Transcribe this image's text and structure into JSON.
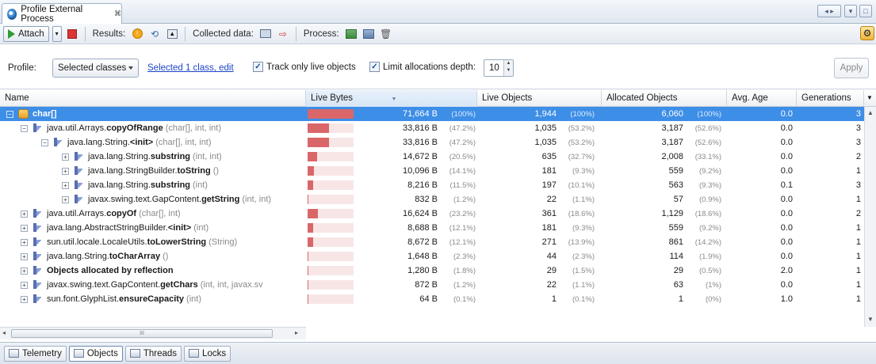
{
  "window": {
    "tab_title": "Profile External Process",
    "tab_close": "⌘"
  },
  "toolbar": {
    "attach_label": "Attach",
    "results_label": "Results:",
    "collected_label": "Collected data:",
    "process_label": "Process:"
  },
  "options": {
    "profile_label": "Profile:",
    "profile_value": "Selected classes",
    "selected_link": "Selected 1 class, edit",
    "track_live_label": "Track only live objects",
    "limit_depth_label": "Limit allocations depth:",
    "depth_value": "10",
    "apply_label": "Apply"
  },
  "columns": [
    "Name",
    "Live Bytes",
    "Live Objects",
    "Allocated Objects",
    "Avg. Age",
    "Generations"
  ],
  "rows": [
    {
      "toggle": "−",
      "pkg": "",
      "bold": "char[]",
      "sig": "",
      "bytes": "71,664 B",
      "bytes_pct": "(100%)",
      "bar": 1.0,
      "live_obj": "1,944",
      "live_pct": "(100%)",
      "alloc": "6,060",
      "alloc_pct": "(100%)",
      "age": "0.0",
      "gen": "3"
    },
    {
      "toggle": "−",
      "pkg": "java.util.Arrays.",
      "bold": "copyOfRange",
      "sig": "(char[], int, int)",
      "bytes": "33,816 B",
      "bytes_pct": "(47.2%)",
      "bar": 0.472,
      "live_obj": "1,035",
      "live_pct": "(53.2%)",
      "alloc": "3,187",
      "alloc_pct": "(52.6%)",
      "age": "0.0",
      "gen": "3"
    },
    {
      "toggle": "−",
      "pkg": "java.lang.String.",
      "bold": "<init>",
      "sig": "(char[], int, int)",
      "bytes": "33,816 B",
      "bytes_pct": "(47.2%)",
      "bar": 0.472,
      "live_obj": "1,035",
      "live_pct": "(53.2%)",
      "alloc": "3,187",
      "alloc_pct": "(52.6%)",
      "age": "0.0",
      "gen": "3"
    },
    {
      "toggle": "+",
      "pkg": "java.lang.String.",
      "bold": "substring",
      "sig": "(int, int)",
      "bytes": "14,672 B",
      "bytes_pct": "(20.5%)",
      "bar": 0.205,
      "live_obj": "635",
      "live_pct": "(32.7%)",
      "alloc": "2,008",
      "alloc_pct": "(33.1%)",
      "age": "0.0",
      "gen": "2"
    },
    {
      "toggle": "+",
      "pkg": "java.lang.StringBuilder.",
      "bold": "toString",
      "sig": "()",
      "bytes": "10,096 B",
      "bytes_pct": "(14.1%)",
      "bar": 0.141,
      "live_obj": "181",
      "live_pct": "(9.3%)",
      "alloc": "559",
      "alloc_pct": "(9.2%)",
      "age": "0.0",
      "gen": "1"
    },
    {
      "toggle": "+",
      "pkg": "java.lang.String.",
      "bold": "substring",
      "sig": "(int)",
      "bytes": "8,216 B",
      "bytes_pct": "(11.5%)",
      "bar": 0.115,
      "live_obj": "197",
      "live_pct": "(10.1%)",
      "alloc": "563",
      "alloc_pct": "(9.3%)",
      "age": "0.1",
      "gen": "3"
    },
    {
      "toggle": "+",
      "pkg": "javax.swing.text.GapContent.",
      "bold": "getString",
      "sig": "(int, int)",
      "bytes": "832 B",
      "bytes_pct": "(1.2%)",
      "bar": 0.012,
      "live_obj": "22",
      "live_pct": "(1.1%)",
      "alloc": "57",
      "alloc_pct": "(0.9%)",
      "age": "0.0",
      "gen": "1"
    },
    {
      "toggle": "+",
      "pkg": "java.util.Arrays.",
      "bold": "copyOf",
      "sig": "(char[], int)",
      "bytes": "16,624 B",
      "bytes_pct": "(23.2%)",
      "bar": 0.232,
      "live_obj": "361",
      "live_pct": "(18.6%)",
      "alloc": "1,129",
      "alloc_pct": "(18.6%)",
      "age": "0.0",
      "gen": "2"
    },
    {
      "toggle": "+",
      "pkg": "java.lang.AbstractStringBuilder.",
      "bold": "<init>",
      "sig": "(int)",
      "bytes": "8,688 B",
      "bytes_pct": "(12.1%)",
      "bar": 0.121,
      "live_obj": "181",
      "live_pct": "(9.3%)",
      "alloc": "559",
      "alloc_pct": "(9.2%)",
      "age": "0.0",
      "gen": "1"
    },
    {
      "toggle": "+",
      "pkg": "sun.util.locale.LocaleUtils.",
      "bold": "toLowerString",
      "sig": "(String)",
      "bytes": "8,672 B",
      "bytes_pct": "(12.1%)",
      "bar": 0.121,
      "live_obj": "271",
      "live_pct": "(13.9%)",
      "alloc": "861",
      "alloc_pct": "(14.2%)",
      "age": "0.0",
      "gen": "1"
    },
    {
      "toggle": "+",
      "pkg": "java.lang.String.",
      "bold": "toCharArray",
      "sig": "()",
      "bytes": "1,648 B",
      "bytes_pct": "(2.3%)",
      "bar": 0.023,
      "live_obj": "44",
      "live_pct": "(2.3%)",
      "alloc": "114",
      "alloc_pct": "(1.9%)",
      "age": "0.0",
      "gen": "1"
    },
    {
      "toggle": "+",
      "pkg": "",
      "bold": "Objects allocated by reflection",
      "sig": "",
      "bytes": "1,280 B",
      "bytes_pct": "(1.8%)",
      "bar": 0.018,
      "live_obj": "29",
      "live_pct": "(1.5%)",
      "alloc": "29",
      "alloc_pct": "(0.5%)",
      "age": "2.0",
      "gen": "1"
    },
    {
      "toggle": "+",
      "pkg": "javax.swing.text.GapContent.",
      "bold": "getChars",
      "sig": "(int, int, javax.sv",
      "bytes": "872 B",
      "bytes_pct": "(1.2%)",
      "bar": 0.012,
      "live_obj": "22",
      "live_pct": "(1.1%)",
      "alloc": "63",
      "alloc_pct": "(1%)",
      "age": "0.0",
      "gen": "1"
    },
    {
      "toggle": "+",
      "pkg": "sun.font.GlyphList.",
      "bold": "ensureCapacity",
      "sig": "(int)",
      "bytes": "64 B",
      "bytes_pct": "(0.1%)",
      "bar": 0.001,
      "live_obj": "1",
      "live_pct": "(0.1%)",
      "alloc": "1",
      "alloc_pct": "(0%)",
      "age": "1.0",
      "gen": "1"
    }
  ],
  "scroll": {
    "hthumb": "III"
  },
  "bottom_tabs": [
    "Telemetry",
    "Objects",
    "Threads",
    "Locks"
  ],
  "colors": {
    "selection": "#3d8ee6",
    "bar": "#d9676a",
    "link": "#1c45c8"
  }
}
